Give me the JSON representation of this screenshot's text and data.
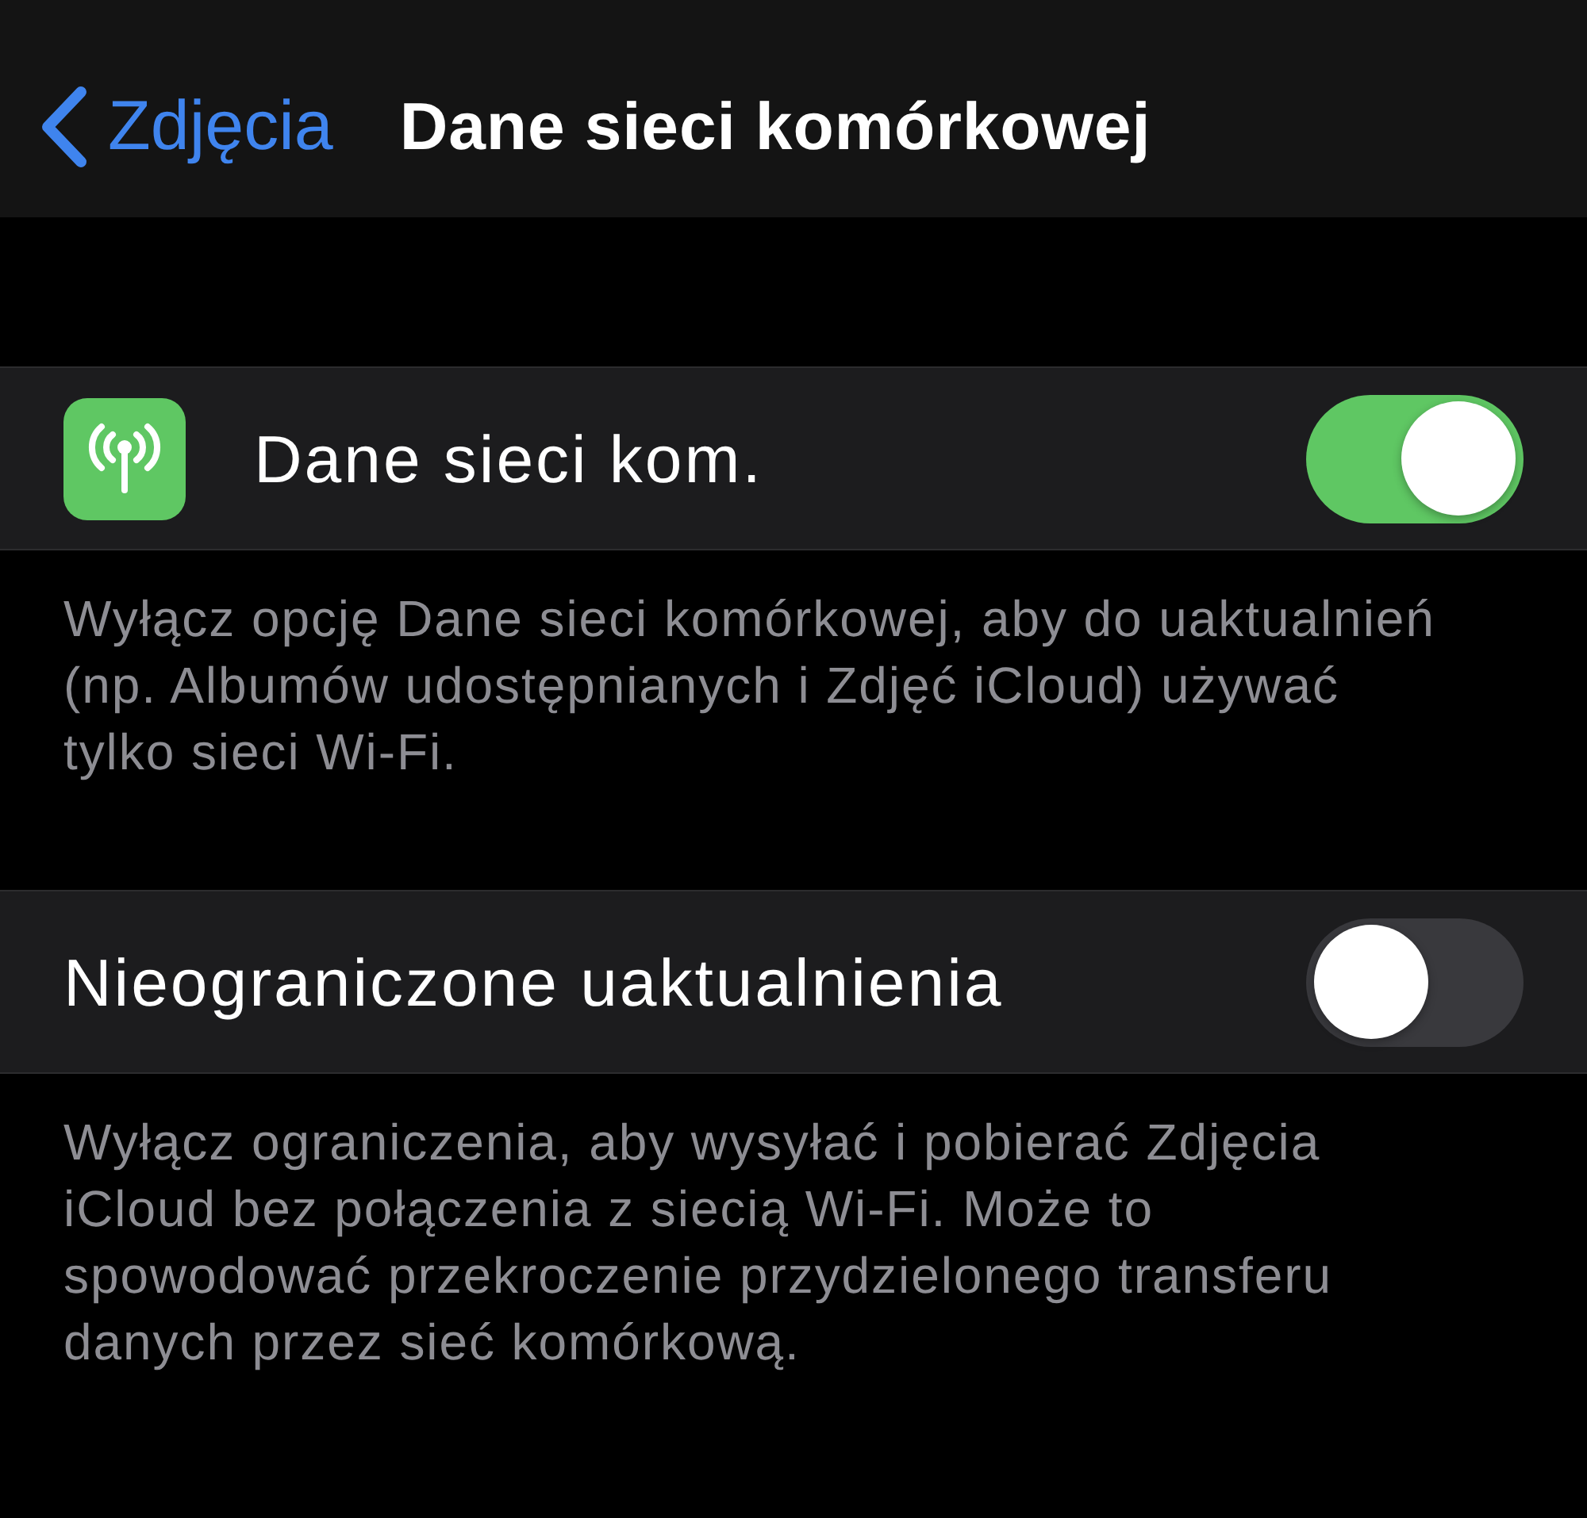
{
  "nav": {
    "back_label": "Zdjęcia",
    "title": "Dane sieci komórkowej"
  },
  "sections": [
    {
      "row": {
        "kind": "icon_toggle",
        "label": "Dane sieci kom.",
        "on": true
      },
      "footer": "Wyłącz opcję Dane sieci komórkowej, aby do uaktualnień (np. Albumów udostępnianych i Zdjęć iCloud) używać tylko sieci Wi-Fi."
    },
    {
      "row": {
        "kind": "toggle",
        "label": "Nieograniczone uaktualnienia",
        "on": false
      },
      "footer": "Wyłącz ograniczenia, aby wysyłać i pobierać Zdjęcia iCloud bez połączenia z siecią Wi-Fi. Może to spowodować przekroczenie przydzielonego transferu danych przez sieć komórkową."
    }
  ]
}
